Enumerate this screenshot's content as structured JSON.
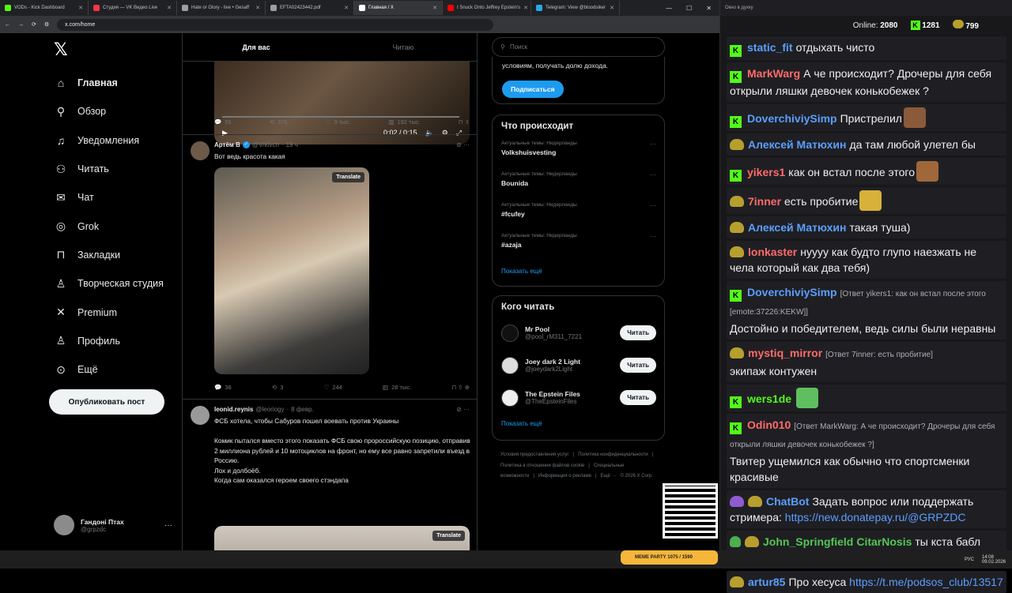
{
  "browser": {
    "tabs": [
      {
        "label": "VODs - Kick Dashboard",
        "color": "#53fc18"
      },
      {
        "label": "Студия — VK Видео Live",
        "color": "#ff3347"
      },
      {
        "label": "Hate or Glory - live • Gesaff",
        "color": "#9e9e9e"
      },
      {
        "label": "EFTA02423442.pdf",
        "color": "#9e9e9e"
      },
      {
        "label": "Главная / X",
        "color": "#ffffff"
      },
      {
        "label": "I Snuck Onto Jeffrey Epstein's",
        "color": "#ff0000"
      },
      {
        "label": "Telegram: View @bloodsiker",
        "color": "#29a9eb"
      }
    ],
    "url": "x.com/home",
    "active_tab": 4
  },
  "sidebar": {
    "items": [
      {
        "label": "Главная",
        "icon": "home-icon",
        "glyph": "⌂"
      },
      {
        "label": "Обзор",
        "icon": "search-icon",
        "glyph": "⚲"
      },
      {
        "label": "Уведомления",
        "icon": "bell-icon",
        "glyph": "♫"
      },
      {
        "label": "Читать",
        "icon": "follow-icon",
        "glyph": "⚇"
      },
      {
        "label": "Чат",
        "icon": "mail-icon",
        "glyph": "✉"
      },
      {
        "label": "Grok",
        "icon": "grok-icon",
        "glyph": "◎"
      },
      {
        "label": "Закладки",
        "icon": "bookmark-icon",
        "glyph": "⊓"
      },
      {
        "label": "Творческая студия",
        "icon": "studio-icon",
        "glyph": "♙"
      },
      {
        "label": "Premium",
        "icon": "x-icon",
        "glyph": "✕"
      },
      {
        "label": "Профиль",
        "icon": "profile-icon",
        "glyph": "♙"
      },
      {
        "label": "Ещё",
        "icon": "more-icon",
        "glyph": "⊙"
      }
    ],
    "post_button": "Опубликовать пост",
    "user_name": "Гандоні Птах",
    "user_handle": "@grpzdc"
  },
  "feed": {
    "tab_for_you": "Для вас",
    "tab_following": "Читаю",
    "video": {
      "time": "0:02 / 0:15",
      "replies": "55",
      "reposts": "376",
      "likes": "3 тыс.",
      "views": "192 тыс."
    },
    "tweet1": {
      "name": "Артём В",
      "handle": "@Vrklvch",
      "time": "19 ч",
      "text": "Вот ведь красота какая",
      "translate": "Translate",
      "replies": "38",
      "reposts": "3",
      "likes": "244",
      "views": "28 тыс."
    },
    "tweet2": {
      "name": "leonid.reynis",
      "handle": "@leoriogy",
      "time": "8 февр.",
      "text": "ФСБ хотела, чтобы Сабуров пошел воевать против Украины\n\nКомик пытался вместо этого показать ФСБ свою пророссийскую позицию, отправив 2 миллиона рублей и 10 мотоциклов на фронт, но ему все равно запретили въезд в Россию.\nЛох и долбоёб.\nКогда сам оказался героем своего стэндапа",
      "translate": "Translate"
    }
  },
  "rightcol": {
    "search_placeholder": "Поиск",
    "premium_text": "условиям, получать долю дохода.",
    "subscribe": "Подписаться",
    "trends_title": "Что происходит",
    "trends": [
      {
        "context": "Актуальные темы: Нидерланды",
        "name": "Volkshuisvesting"
      },
      {
        "context": "Актуальные темы: Нидерланды",
        "name": "Bounida"
      },
      {
        "context": "Актуальные темы: Нидерланды",
        "name": "#fcufey"
      },
      {
        "context": "Актуальные темы: Нидерланды",
        "name": "#azaja"
      }
    ],
    "show_more": "Показать ещё",
    "who_title": "Кого читать",
    "who": [
      {
        "name": "Mr Pool",
        "handle": "@pool_rM311_7221",
        "follow": "Читать"
      },
      {
        "name": "Joey dark 2 Light",
        "handle": "@joeydark2Light",
        "follow": "Читать"
      },
      {
        "name": "The Epstein Files",
        "handle": "@TheEpsteinFiles",
        "follow": "Читать"
      }
    ],
    "footer": [
      "Условия предоставления услуг",
      "|",
      "Политика конфиденциальности",
      "|",
      "Политика в отношении файлов cookie",
      "|",
      "Специальные возможности",
      "|",
      "Информация о рекламе",
      "|",
      "Ещё ···",
      "© 2026 X Corp."
    ]
  },
  "chat": {
    "window_title": "Окно в духку",
    "online_label": "Online:",
    "online": "2080",
    "kick_count": "1281",
    "vk_count": "799",
    "messages": [
      {
        "user": "static_fit",
        "color": "#5b9eff",
        "badge": "kick",
        "text": "отдыхать чисто"
      },
      {
        "user": "MarkWarg",
        "color": "#ff6b6b",
        "badge": "kick",
        "text": "А че происходит? Дрочеры для себя открыли ляшки девочек конькобежек ?"
      },
      {
        "user": "DoverchiviySimp",
        "color": "#5b9eff",
        "badge": "kick",
        "text": "Пристрелил",
        "emote": "#8a5a3a"
      },
      {
        "user": "Алексей Матюхин",
        "color": "#5b9eff",
        "badge": "vk",
        "text": "да там любой улетел бы"
      },
      {
        "user": "yikers1",
        "color": "#ff6b6b",
        "badge": "kick",
        "text": "как он встал после этого",
        "emote": "#a0683a"
      },
      {
        "user": "7inner",
        "color": "#ff6b6b",
        "badge": "vk",
        "text": "есть пробитие",
        "emote": "#d8b13a"
      },
      {
        "user": "Алексей Матюхин",
        "color": "#5b9eff",
        "badge": "vk",
        "text": "такая туша)"
      },
      {
        "user": "lonkaster",
        "color": "#ff6b6b",
        "badge": "vk",
        "text": "нуууу как будто глупо наезжать не чела который как два тебя)"
      },
      {
        "user": "DoverchiviySimp",
        "color": "#5b9eff",
        "badge": "kick",
        "reply": "[Ответ yikers1: как он встал после этого [emote:37226:KEKW]]",
        "text": "Достойно и победителем, ведь силы были неравны"
      },
      {
        "user": "mystiq_mirror",
        "color": "#ff6b6b",
        "badge": "vk",
        "reply": "[Ответ 7inner: есть пробитие]",
        "text": "экипаж контужен"
      },
      {
        "user": "wers1de",
        "color": "#53fc18",
        "badge": "kick",
        "text": "",
        "emote": "#5fbf5f"
      },
      {
        "user": "Odin010",
        "color": "#ff6b6b",
        "badge": "kick",
        "reply": "[Ответ MarkWarg: А че происходит? Дрочеры для себя открыли ляшки девочек конькобежек ?]",
        "text": "Твитер ущемился как обычно что спортсменки красивые"
      },
      {
        "user": "ChatBot",
        "color": "#5b9eff",
        "badge": "bot",
        "text": "Задать вопрос или поддержать стримера:",
        "link": "https://new.donatepay.ru/@GRPZDC"
      },
      {
        "user": "John_Springfield",
        "color": "#53c653",
        "badge": "vk2",
        "mention": "CitarNosis",
        "text": "ты кста бабл квасер"
      },
      {
        "user": "artur85",
        "color": "#5b9eff",
        "badge": "vk",
        "text": "Про хесуса",
        "link": "https://t.me/podsos_club/13517"
      }
    ]
  },
  "taskbar": {
    "lang": "РУС",
    "clock": "14:08",
    "date": "09.02.2026",
    "meme_party": "MEME PARTY",
    "progress": "1075 / 1590"
  }
}
